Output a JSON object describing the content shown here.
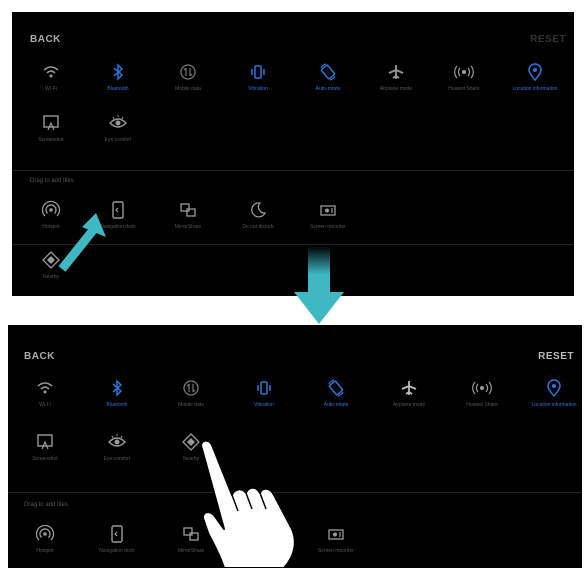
{
  "top_panel": {
    "back_label": "BACK",
    "reset_label": "RESET",
    "active_tiles": [
      {
        "name": "wifi",
        "label": "Wi-Fi",
        "icon": "wifi-icon",
        "active": false
      },
      {
        "name": "bluetooth",
        "label": "Bluetooth",
        "icon": "bluetooth-icon",
        "active": true
      },
      {
        "name": "mobile-data",
        "label": "Mobile data",
        "icon": "mobile-data-icon",
        "active": false
      },
      {
        "name": "vibration",
        "label": "Vibration",
        "icon": "vibration-icon",
        "active": true
      },
      {
        "name": "auto-rotate",
        "label": "Auto-rotate",
        "icon": "auto-rotate-icon",
        "active": true
      },
      {
        "name": "airplane-mode",
        "label": "Airplane mode",
        "icon": "airplane-icon",
        "active": false
      },
      {
        "name": "huawei-share",
        "label": "Huawei Share",
        "icon": "huawei-share-icon",
        "active": false
      },
      {
        "name": "location",
        "label": "Location information",
        "icon": "location-icon",
        "active": true
      },
      {
        "name": "screenshot",
        "label": "Screenshot",
        "icon": "screenshot-icon",
        "active": false
      },
      {
        "name": "eye-comfort",
        "label": "Eye comfort",
        "icon": "eye-icon",
        "active": false
      }
    ],
    "drag_section_label": "Drag to add tiles",
    "inactive_tiles": [
      {
        "name": "hotspot",
        "label": "Hotspot",
        "icon": "hotspot-icon"
      },
      {
        "name": "navigation-dock",
        "label": "Navigation dock",
        "icon": "navigation-dock-icon"
      },
      {
        "name": "mirrorshare",
        "label": "MirrorShare",
        "icon": "mirrorshare-icon"
      },
      {
        "name": "do-not-disturb",
        "label": "Do not disturb",
        "icon": "moon-icon"
      },
      {
        "name": "screen-recorder",
        "label": "Screen recorder",
        "icon": "screen-recorder-icon"
      },
      {
        "name": "nearby",
        "label": "Nearby",
        "icon": "nearby-icon"
      }
    ]
  },
  "bottom_panel": {
    "back_label": "BACK",
    "reset_label": "RESET",
    "active_tiles": [
      {
        "name": "wifi",
        "label": "Wi-Fi",
        "icon": "wifi-icon",
        "active": false
      },
      {
        "name": "bluetooth",
        "label": "Bluetooth",
        "icon": "bluetooth-icon",
        "active": true
      },
      {
        "name": "mobile-data",
        "label": "Mobile data",
        "icon": "mobile-data-icon",
        "active": false
      },
      {
        "name": "vibration",
        "label": "Vibration",
        "icon": "vibration-icon",
        "active": true
      },
      {
        "name": "auto-rotate",
        "label": "Auto-rotate",
        "icon": "auto-rotate-icon",
        "active": true
      },
      {
        "name": "airplane-mode",
        "label": "Airplane mode",
        "icon": "airplane-icon",
        "active": false
      },
      {
        "name": "huawei-share",
        "label": "Huawei Share",
        "icon": "huawei-share-icon",
        "active": false
      },
      {
        "name": "location",
        "label": "Location information",
        "icon": "location-icon",
        "active": true
      },
      {
        "name": "screenshot",
        "label": "Screenshot",
        "icon": "screenshot-icon",
        "active": false
      },
      {
        "name": "eye-comfort",
        "label": "Eye comfort",
        "icon": "eye-icon",
        "active": false
      },
      {
        "name": "nearby",
        "label": "Nearby",
        "icon": "nearby-icon",
        "active": false
      }
    ],
    "drag_section_label": "Drag to add tiles",
    "inactive_tiles": [
      {
        "name": "hotspot",
        "label": "Hotspot",
        "icon": "hotspot-icon"
      },
      {
        "name": "navigation-dock",
        "label": "Navigation dock",
        "icon": "navigation-dock-icon"
      },
      {
        "name": "mirrorshare",
        "label": "MirrorShare",
        "icon": "mirrorshare-icon"
      },
      {
        "name": "screen-recorder",
        "label": "Screen recorder",
        "icon": "screen-recorder-icon"
      }
    ]
  },
  "colors": {
    "background": "#000000",
    "active_blue": "#2f73d6",
    "inactive_gray": "#888888",
    "arrow_teal": "#3fb8c4"
  }
}
